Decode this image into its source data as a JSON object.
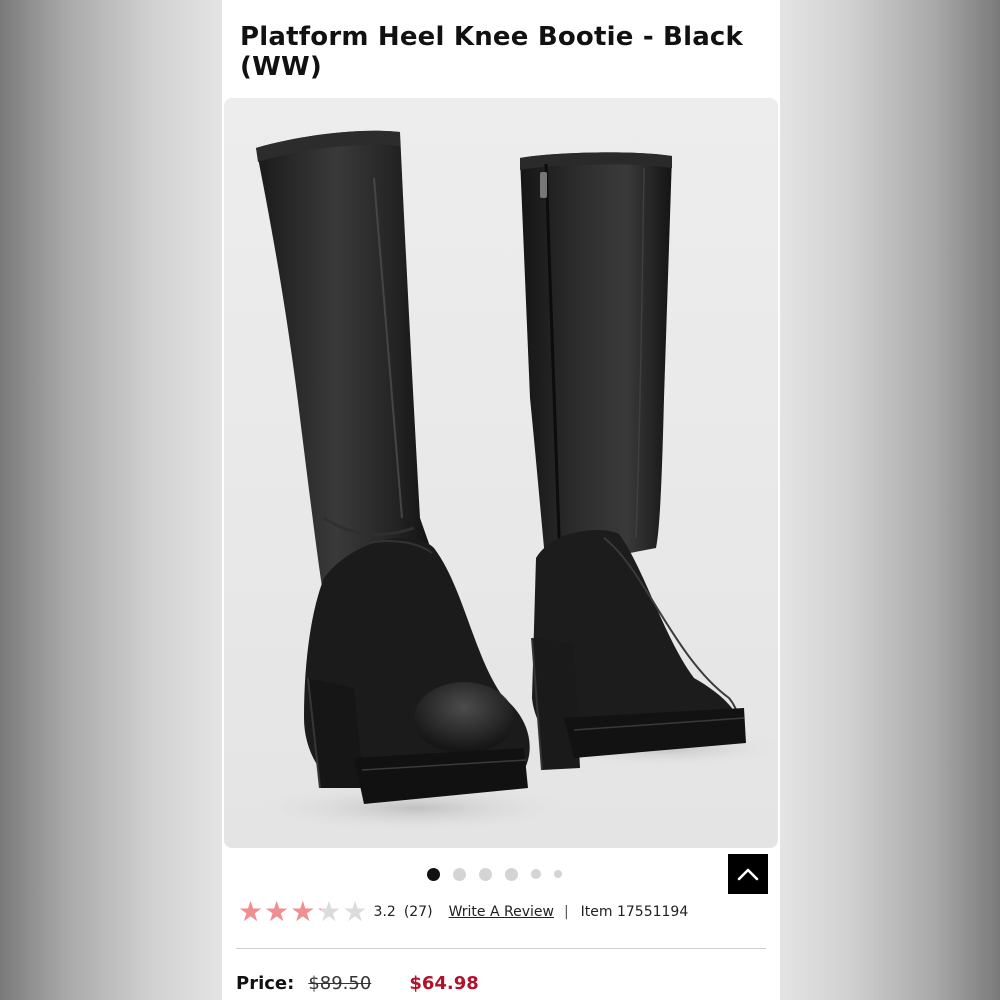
{
  "product": {
    "title": "Platform Heel Knee Bootie - Black (WW)",
    "image_alt": "Black faux leather knee high platform boots"
  },
  "gallery": {
    "dot_count": 6,
    "active_index": 0
  },
  "rating": {
    "value": 3.2,
    "value_text": "3.2",
    "count_text": "(27)",
    "write_review_label": "Write A Review",
    "separator": "|",
    "item_text": "Item 17551194",
    "star_filled_color": "#ef8f8f",
    "star_empty_color": "#dcdcdc"
  },
  "price": {
    "label": "Price:",
    "original": "$89.50",
    "sale": "$64.98",
    "sale_color": "#b0122a"
  },
  "icons": {
    "zoom": "zoom-hand-icon",
    "back_to_top": "chevron-up-icon"
  }
}
